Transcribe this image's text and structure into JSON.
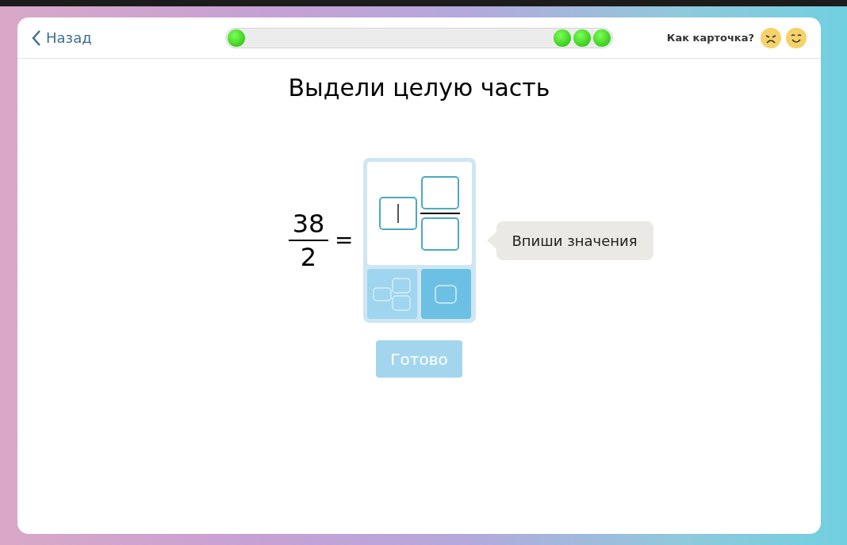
{
  "header": {
    "back": "Назад",
    "rating_prompt": "Как карточка?"
  },
  "progress": {
    "level": 0
  },
  "title": "Выдели целую часть",
  "expression": {
    "numerator": "38",
    "denominator": "2",
    "equals": "="
  },
  "answer_fields": [
    {
      "kind": "whole",
      "focused": true
    },
    {
      "kind": "numerator",
      "focused": false
    },
    {
      "kind": "denominator",
      "focused": false
    }
  ],
  "modes": [
    {
      "kind": "mixed",
      "selected": false
    },
    {
      "kind": "whole",
      "selected": true
    }
  ],
  "hint": "Впиши значения",
  "done_button": {
    "label": "Готово",
    "disabled": true
  }
}
